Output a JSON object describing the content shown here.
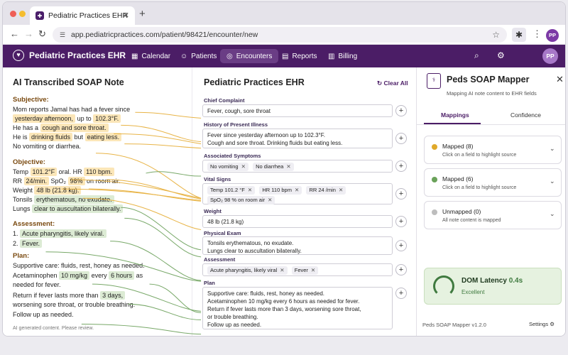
{
  "browser": {
    "tab_title": "Pediatric Practices EHR",
    "url": "app.pediatricpractices.com/patient/98421/encounter/new",
    "avatar": "PP"
  },
  "app": {
    "brand": "Pediatric Practices EHR",
    "nav": [
      "Calendar",
      "Patients",
      "Encounters",
      "Reports",
      "Billing"
    ],
    "avatar": "PP"
  },
  "soap": {
    "title": "AI Transcribed SOAP Note",
    "subjective_h": "Subjective:",
    "s1": "Mom reports Jamal has had a fever since",
    "s2a": "yesterday afternoon,",
    "s2b": " up to ",
    "s2c": "102.3°F.",
    "s3a": "He has a ",
    "s3b": "cough and sore throat.",
    "s4a": "He is ",
    "s4b": "drinking fluids",
    "s4c": " but ",
    "s4d": "eating less.",
    "s5": "No vomiting or diarrhea.",
    "objective_h": "Objective:",
    "o1a": "Temp ",
    "o1b": "101.2°F",
    "o1c": " oral. HR ",
    "o1d": "110 bpm.",
    "o2a": "RR ",
    "o2b": "24/min.",
    "o2c": " SpO₂ ",
    "o2d": "98%",
    "o2e": " on room air.",
    "o3a": "Weight ",
    "o3b": "48 lb (21.8 kg).",
    "o4a": "Tonsils ",
    "o4b": "erythematous, no exudate.",
    "o5a": "Lungs ",
    "o5b": "clear to auscultation bilaterally.",
    "assessment_h": "Assessment:",
    "a1a": "1. ",
    "a1b": "Acute pharyngitis, likely viral.",
    "a2a": "2. ",
    "a2b": "Fever.",
    "plan_h": "Plan:",
    "p1": "Supportive care: fluids, rest, honey as needed.",
    "p2a": "Acetaminophen ",
    "p2b": "10 mg/kg",
    "p2c": " every ",
    "p2d": "6 hours",
    "p2e": " as",
    "p3": "needed for fever.",
    "p4a": "Return if fever lasts more than ",
    "p4b": "3 days,",
    "p5": "worsening sore throat, or trouble breathing.",
    "p6a": "Follow up as needed.",
    "note": "AI generated content. Please review."
  },
  "form": {
    "title": "Pediatric Practices EHR",
    "clear_all": "Clear All",
    "chief_label": "Chief Complaint",
    "chief_value": "Fever, cough, sore throat",
    "hpi_label": "History of Present Illness",
    "hpi_line1": "Fever since yesterday afternoon up to 102.3°F.",
    "hpi_line2": "Cough and sore throat. Drinking fluids but eating less.",
    "assoc_label": "Associated Symptoms",
    "assoc_chips": [
      "No vomiting",
      "No diarrhea"
    ],
    "vitals_label": "Vital Signs",
    "vitals_row1": [
      "Temp  101.2 °F",
      "HR  110 bpm",
      "RR  24 /min"
    ],
    "vitals_row2": [
      "SpO₂  98 %  on room air"
    ],
    "weight_label": "Weight",
    "weight_value": "48 lb (21.8 kg)",
    "exam_label": "Physical Exam",
    "exam_line1": "Tonsils erythematous, no exudate.",
    "exam_line2": "Lungs clear to auscultation bilaterally.",
    "assess_label": "Assessment",
    "assess_chips": [
      "Acute pharyngitis, likely viral",
      "Fever"
    ],
    "plan_label": "Plan",
    "plan_lines": [
      "Supportive care: fluids, rest, honey as needed.",
      "Acetaminophen 10 mg/kg every 6 hours as needed for fever.",
      "Return if fever lasts more than 3 days, worsening sore throat,",
      "or trouble breathing.",
      "Follow up as needed."
    ]
  },
  "mapper": {
    "title": "Peds SOAP Mapper",
    "subtitle": "Mapping AI note content to EHR fields",
    "tabs": [
      "Mappings",
      "Confidence"
    ],
    "cards": [
      {
        "title": "Mapped (8)",
        "sub": "Click on a field to highlight source",
        "color": "#e0a92a"
      },
      {
        "title": "Mapped (6)",
        "sub": "Click on a field to highlight source",
        "color": "#6aa25a"
      },
      {
        "title": "Unmapped (0)",
        "sub": "All note content is mapped",
        "color": "#bdbdbd"
      }
    ],
    "latency_label": "DOM Latency",
    "latency_value": "0.4s",
    "latency_status": "Excellent",
    "version": "Peds SOAP Mapper v1.2.0",
    "settings": "Settings"
  },
  "colors": {
    "brand": "#4b1d66",
    "yellow_link": "#e8b447",
    "green_link": "#78a868"
  }
}
